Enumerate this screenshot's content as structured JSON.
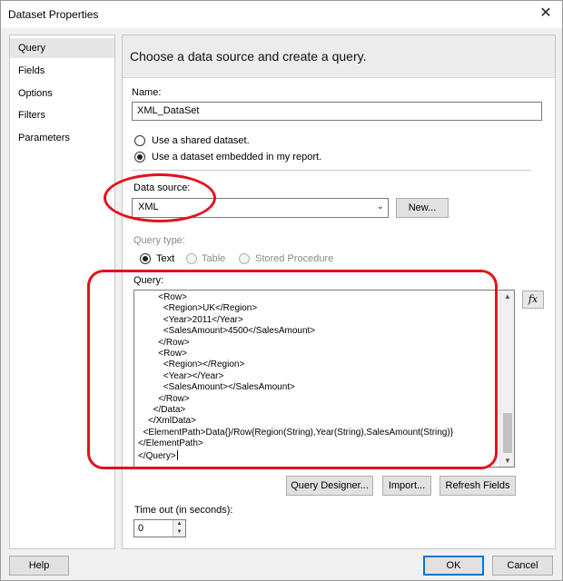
{
  "window": {
    "title": "Dataset Properties",
    "close_glyph": "✕"
  },
  "nav": {
    "items": [
      {
        "label": "Query",
        "selected": true
      },
      {
        "label": "Fields",
        "selected": false
      },
      {
        "label": "Options",
        "selected": false
      },
      {
        "label": "Filters",
        "selected": false
      },
      {
        "label": "Parameters",
        "selected": false
      }
    ]
  },
  "main": {
    "heading": "Choose a data source and create a query.",
    "name_label": "Name:",
    "name_value": "XML_DataSet",
    "radio_shared": "Use a shared dataset.",
    "radio_embedded": "Use a dataset embedded in my report.",
    "datasource_label": "Data source:",
    "datasource_value": "XML",
    "new_button": "New...",
    "querytype_label": "Query type:",
    "querytype_text": "Text",
    "querytype_table": "Table",
    "querytype_sp": "Stored Procedure",
    "query_label": "Query:",
    "query_lines": [
      "        <Row>",
      "          <Region>UK</Region>",
      "          <Year>2011</Year>",
      "          <SalesAmount>4500</SalesAmount>",
      "        </Row>",
      "        <Row>",
      "          <Region></Region>",
      "          <Year></Year>",
      "          <SalesAmount></SalesAmount>",
      "        </Row>",
      "      </Data>",
      "    </XmlData>",
      "  <ElementPath>Data{}/Row{Region(String),Year(String),SalesAmount(String)}",
      "</ElementPath>",
      "</Query>"
    ],
    "fx_label": "fx",
    "query_designer_button": "Query Designer...",
    "import_button": "Import...",
    "refresh_button": "Refresh Fields",
    "timeout_label": "Time out (in seconds):",
    "timeout_value": "0"
  },
  "footer": {
    "help_button": "Help",
    "ok_button": "OK",
    "cancel_button": "Cancel"
  },
  "colors": {
    "annotation": "#e0141e",
    "default_button_border": "#0078d7"
  }
}
